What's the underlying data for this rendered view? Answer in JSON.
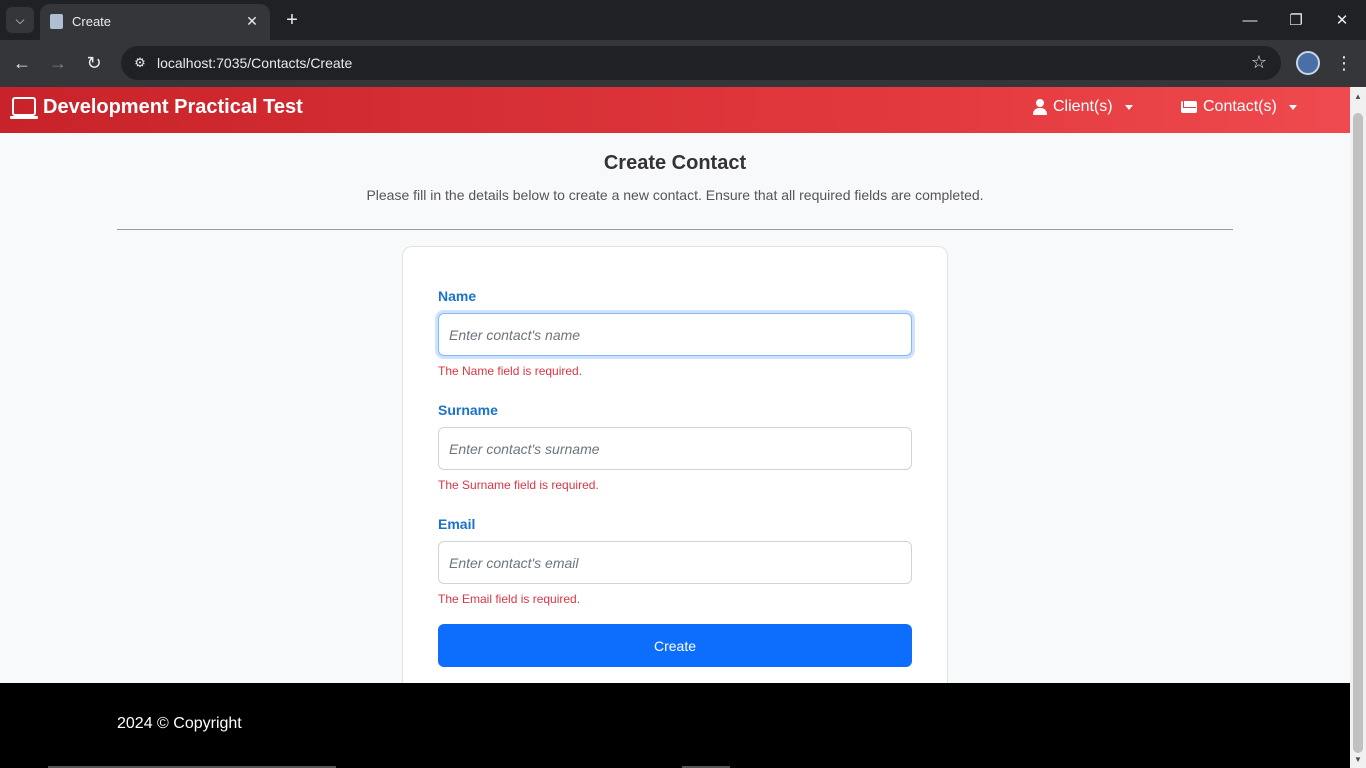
{
  "browser": {
    "tab_title": "Create",
    "url": "localhost:7035/Contacts/Create",
    "icons": {
      "tab_menu": "chevron-down-icon",
      "favicon": "document-icon",
      "close": "close-icon",
      "new_tab": "plus-icon",
      "back": "arrow-left-icon",
      "forward": "arrow-right-icon",
      "reload": "reload-icon",
      "site_info": "tune-icon",
      "bookmark": "star-icon",
      "menu": "kebab-icon"
    }
  },
  "navbar": {
    "brand": "Development Practical Test",
    "items": [
      {
        "label": "Client(s)",
        "icon": "user-icon"
      },
      {
        "label": "Contact(s)",
        "icon": "envelope-icon"
      }
    ],
    "gradient_start": "#c8232a",
    "gradient_end": "#ef4a4f"
  },
  "page": {
    "title": "Create Contact",
    "description": "Please fill in the details below to create a new contact. Ensure that all required fields are completed."
  },
  "form": {
    "fields": [
      {
        "label": "Name",
        "placeholder": "Enter contact's name",
        "value": "",
        "error": "The Name field is required."
      },
      {
        "label": "Surname",
        "placeholder": "Enter contact's surname",
        "value": "",
        "error": "The Surname field is required."
      },
      {
        "label": "Email",
        "placeholder": "Enter contact's email",
        "value": "",
        "error": "The Email field is required."
      }
    ],
    "submit_label": "Create",
    "accent": "#0d6efd",
    "error_color": "#dc3545"
  },
  "footer": {
    "text": "2024 © Copyright"
  }
}
